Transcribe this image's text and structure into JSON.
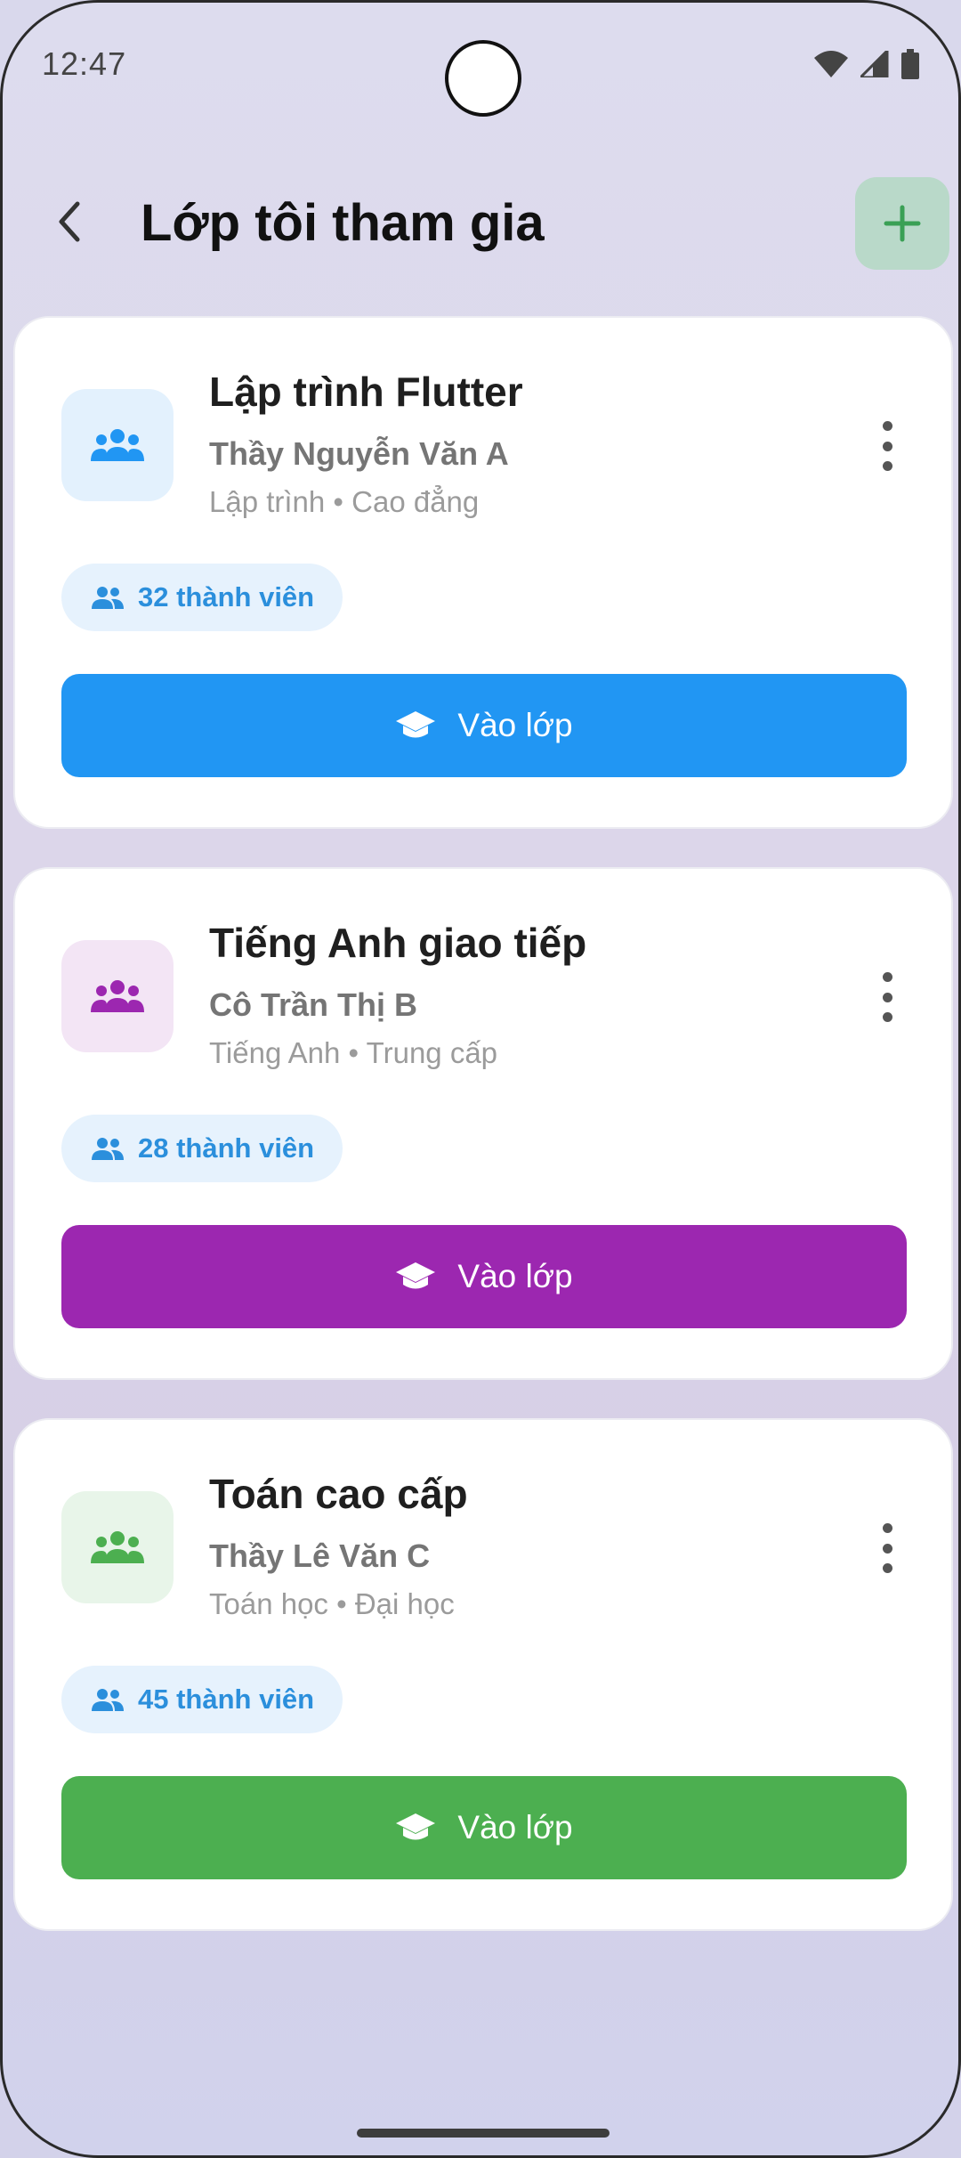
{
  "status_bar": {
    "time": "12:47"
  },
  "header": {
    "title": "Lớp tôi tham gia"
  },
  "classes": [
    {
      "title": "Lập trình Flutter",
      "teacher": "Thầy Nguyễn Văn A",
      "meta": "Lập trình • Cao đẳng",
      "members": "32 thành viên",
      "button_label": "Vào lớp",
      "accent": "#2196f3",
      "icon_bg": "#e3f1fd"
    },
    {
      "title": "Tiếng Anh giao tiếp",
      "teacher": "Cô Trần Thị B",
      "meta": "Tiếng Anh • Trung cấp",
      "members": "28 thành viên",
      "button_label": "Vào lớp",
      "accent": "#9c27b0",
      "icon_bg": "#f3e5f5"
    },
    {
      "title": "Toán cao cấp",
      "teacher": "Thầy Lê Văn C",
      "meta": "Toán học • Đại học",
      "members": "45 thành viên",
      "button_label": "Vào lớp",
      "accent": "#4caf50",
      "icon_bg": "#e8f5e9"
    }
  ],
  "colors": {
    "member_chip_text": "#2b8fdc",
    "member_chip_bg": "#e6f2fd",
    "add_button_bg": "#b9d9c9",
    "add_button_icon": "#3aa055"
  },
  "icons": {
    "back": "chevron-left-icon",
    "add": "plus-icon",
    "class": "group-icon",
    "more": "more-vertical-icon",
    "members": "people-icon",
    "enter": "graduation-cap-icon"
  }
}
